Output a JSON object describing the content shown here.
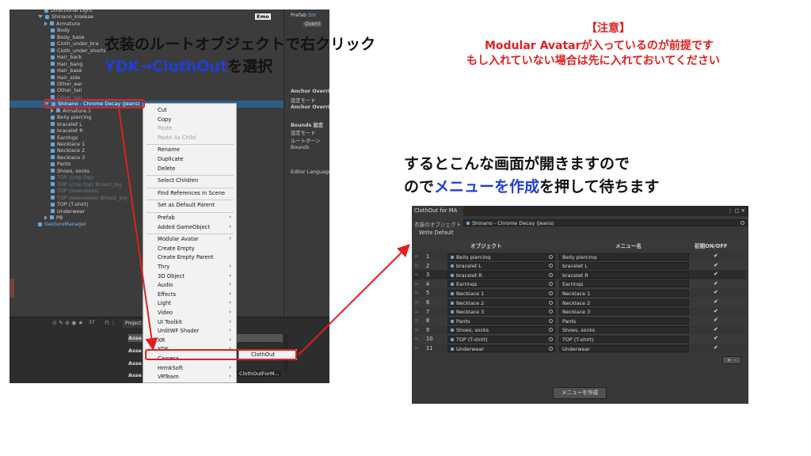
{
  "annotations": {
    "step1_line1": "衣装のルートオブジェクトで右クリック",
    "step1_line2_a": "YDK→ClothOut",
    "step1_line2_b": "を選択",
    "note_title": "【注意】",
    "note_line1": "Modular Avatarが入っているのが前提です",
    "note_line2": "もし入れていない場合は先に入れておいてください",
    "step2_line1": "するとこんな画面が開きますので",
    "step2_line2_a": "ので",
    "step2_line2_b": "メニューを作成",
    "step2_line2_c": "を押して待ちます"
  },
  "colors": {
    "heading": "#111111",
    "accent_blue": "#1f3fd6",
    "warning_red": "#e02020",
    "panel_bg": "#383838",
    "selection": "#2c5d87",
    "menu_bg": "#f2f2f2"
  },
  "hierarchy": {
    "items": [
      {
        "label": "Directional Light",
        "indent": 1,
        "style": "normal",
        "arrow": "none"
      },
      {
        "label": "Shinano_kisekae",
        "indent": 0,
        "style": "normal",
        "arrow": "down"
      },
      {
        "label": "Armature",
        "indent": 1,
        "style": "normal",
        "arrow": "right"
      },
      {
        "label": "Body",
        "indent": 2,
        "style": "normal",
        "arrow": "none"
      },
      {
        "label": "Body_base",
        "indent": 2,
        "style": "normal",
        "arrow": "none"
      },
      {
        "label": "Cloth_under_bra",
        "indent": 2,
        "style": "normal",
        "arrow": "none"
      },
      {
        "label": "Cloth_under_shorts",
        "indent": 2,
        "style": "normal",
        "arrow": "none"
      },
      {
        "label": "Hair_back",
        "indent": 2,
        "style": "normal",
        "arrow": "none"
      },
      {
        "label": "Hair_bang",
        "indent": 2,
        "style": "normal",
        "arrow": "none"
      },
      {
        "label": "Hair_base",
        "indent": 2,
        "style": "normal",
        "arrow": "none"
      },
      {
        "label": "Hair_side",
        "indent": 2,
        "style": "normal",
        "arrow": "none"
      },
      {
        "label": "Other_ear",
        "indent": 2,
        "style": "normal",
        "arrow": "none"
      },
      {
        "label": "Other_tail",
        "indent": 2,
        "style": "normal",
        "arrow": "none"
      },
      {
        "label": "Other_tail",
        "indent": 2,
        "style": "dim",
        "arrow": "none"
      },
      {
        "label": "Shinano - Chrome Decay (Jeans)",
        "indent": 1,
        "style": "sel",
        "arrow": "down"
      },
      {
        "label": "Armature.1",
        "indent": 2,
        "style": "normal",
        "arrow": "right"
      },
      {
        "label": "Belly piercing",
        "indent": 2,
        "style": "normal",
        "arrow": "none"
      },
      {
        "label": "bracelet L",
        "indent": 2,
        "style": "normal",
        "arrow": "none"
      },
      {
        "label": "bracelet R",
        "indent": 2,
        "style": "normal",
        "arrow": "none"
      },
      {
        "label": "Earrings",
        "indent": 2,
        "style": "normal",
        "arrow": "none"
      },
      {
        "label": "Necklace 1",
        "indent": 2,
        "style": "normal",
        "arrow": "none"
      },
      {
        "label": "Necklace 2",
        "indent": 2,
        "style": "normal",
        "arrow": "none"
      },
      {
        "label": "Necklace 3",
        "indent": 2,
        "style": "normal",
        "arrow": "none"
      },
      {
        "label": "Pants",
        "indent": 2,
        "style": "normal",
        "arrow": "none"
      },
      {
        "label": "Shoes, socks",
        "indent": 2,
        "style": "normal",
        "arrow": "none"
      },
      {
        "label": "TOP (crop top)",
        "indent": 2,
        "style": "dim",
        "arrow": "none"
      },
      {
        "label": "TOP (crop top) Breast_big",
        "indent": 2,
        "style": "dim",
        "arrow": "none"
      },
      {
        "label": "TOP (sleeveless)",
        "indent": 2,
        "style": "dim",
        "arrow": "none"
      },
      {
        "label": "TOP (sleeveless) Breast_big",
        "indent": 2,
        "style": "dim",
        "arrow": "none"
      },
      {
        "label": "TOP (T-shirt)",
        "indent": 2,
        "style": "normal",
        "arrow": "none"
      },
      {
        "label": "Underwear",
        "indent": 2,
        "style": "normal",
        "arrow": "none"
      },
      {
        "label": "PB",
        "indent": 1,
        "style": "normal",
        "arrow": "right"
      },
      {
        "label": "GestureManager",
        "indent": 0,
        "style": "blue",
        "arrow": "none"
      }
    ],
    "emo_badge": "Emo"
  },
  "inspector": {
    "prefab_label": "Prefab",
    "prefab_value": "Shi",
    "override_button": "Overri",
    "lines": [
      "Anchor Override",
      "設定モード",
      "Anchor Overri",
      "",
      "Bounds 設定",
      "設定モード",
      "ルートボーン",
      "Bounds",
      "",
      "",
      "Editor Language"
    ]
  },
  "project": {
    "tab": "Project",
    "count": "37",
    "asset_rows": [
      "Asse",
      "Asse",
      "Asse",
      "Asse"
    ],
    "bottom_label": "ClothOutForM..."
  },
  "context_menu": {
    "items": [
      {
        "label": "Cut",
        "disabled": false,
        "submenu": false
      },
      {
        "label": "Copy",
        "disabled": false,
        "submenu": false
      },
      {
        "label": "Paste",
        "disabled": true,
        "submenu": false
      },
      {
        "label": "Paste As Child",
        "disabled": true,
        "submenu": false
      },
      {
        "label": "SEP"
      },
      {
        "label": "Rename",
        "disabled": false,
        "submenu": false
      },
      {
        "label": "Duplicate",
        "disabled": false,
        "submenu": false
      },
      {
        "label": "Delete",
        "disabled": false,
        "submenu": false
      },
      {
        "label": "SEP"
      },
      {
        "label": "Select Children",
        "disabled": false,
        "submenu": false
      },
      {
        "label": "SEP"
      },
      {
        "label": "Find References in Scene",
        "disabled": false,
        "submenu": false
      },
      {
        "label": "SEP"
      },
      {
        "label": "Set as Default Parent",
        "disabled": false,
        "submenu": false
      },
      {
        "label": "SEP"
      },
      {
        "label": "Prefab",
        "disabled": false,
        "submenu": true
      },
      {
        "label": "Added GameObject",
        "disabled": false,
        "submenu": true
      },
      {
        "label": "SEP"
      },
      {
        "label": "Modular Avatar",
        "disabled": false,
        "submenu": true
      },
      {
        "label": "Create Empty",
        "disabled": false,
        "submenu": false
      },
      {
        "label": "Create Empty Parent",
        "disabled": false,
        "submenu": false
      },
      {
        "label": "Thry",
        "disabled": false,
        "submenu": true
      },
      {
        "label": "3D Object",
        "disabled": false,
        "submenu": true
      },
      {
        "label": "Audio",
        "disabled": false,
        "submenu": true
      },
      {
        "label": "Effects",
        "disabled": false,
        "submenu": true
      },
      {
        "label": "Light",
        "disabled": false,
        "submenu": true
      },
      {
        "label": "Video",
        "disabled": false,
        "submenu": true
      },
      {
        "label": "UI Toolkit",
        "disabled": false,
        "submenu": true
      },
      {
        "label": "UnlitWF Shader",
        "disabled": false,
        "submenu": true
      },
      {
        "label": "XR",
        "disabled": false,
        "submenu": true
      },
      {
        "label": "YDK",
        "disabled": false,
        "submenu": true
      },
      {
        "label": "Camera",
        "disabled": false,
        "submenu": false
      },
      {
        "label": "HrmkSoft",
        "disabled": false,
        "submenu": true
      },
      {
        "label": "VRTeam",
        "disabled": false,
        "submenu": true
      }
    ],
    "submenu_item": "ClothOut"
  },
  "clothout_window": {
    "title": "ClothOut for MA",
    "target_label": "衣装のオブジェクト",
    "target_value": "Shinano - Chrome Decay (Jeans)",
    "write_default": "Write Default",
    "col_object": "オブジェクト",
    "col_menu": "メニュー名",
    "col_default": "初期ON/OFF",
    "rows": [
      {
        "index": "1",
        "object": "Belly piercing",
        "menu": "Belly piercing",
        "on": "✔"
      },
      {
        "index": "2",
        "object": "bracelet L",
        "menu": "bracelet L",
        "on": "✔"
      },
      {
        "index": "3",
        "object": "bracelet R",
        "menu": "bracelet R",
        "on": "✔"
      },
      {
        "index": "4",
        "object": "Earrings",
        "menu": "Earrings",
        "on": "✔"
      },
      {
        "index": "5",
        "object": "Necklace 1",
        "menu": "Necklace 1",
        "on": "✔"
      },
      {
        "index": "6",
        "object": "Necklace 2",
        "menu": "Necklace 2",
        "on": "✔"
      },
      {
        "index": "7",
        "object": "Necklace 3",
        "menu": "Necklace 3",
        "on": "✔"
      },
      {
        "index": "8",
        "object": "Pants",
        "menu": "Pants",
        "on": "✔"
      },
      {
        "index": "9",
        "object": "Shoes, socks",
        "menu": "Shoes, socks",
        "on": "✔"
      },
      {
        "index": "10",
        "object": "TOP (T-shirt)",
        "menu": "TOP (T-shirt)",
        "on": "✔"
      },
      {
        "index": "11",
        "object": "Underwear",
        "menu": "Underwear",
        "on": "✔"
      }
    ],
    "add_button": "+",
    "remove_button": "-",
    "create_button": "メニューを作成",
    "window_controls": "⋮ ▢ ✕"
  }
}
